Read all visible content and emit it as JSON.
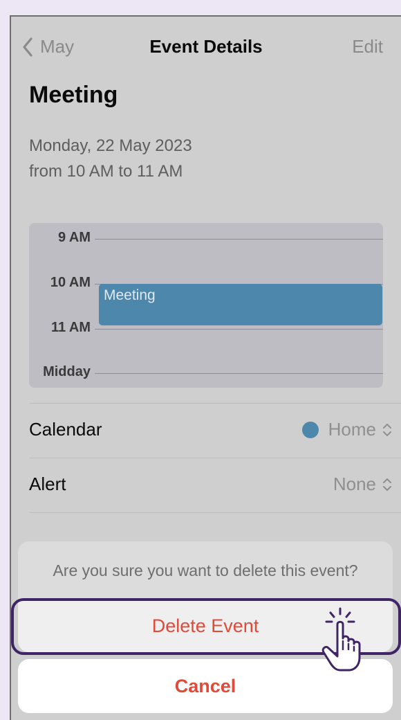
{
  "nav": {
    "back_label": "May",
    "title": "Event Details",
    "edit_label": "Edit"
  },
  "event": {
    "title": "Meeting",
    "date": "Monday, 22 May 2023",
    "time": "from 10 AM to 11 AM"
  },
  "timeline": {
    "hours": [
      "9 AM",
      "10 AM",
      "11 AM",
      "Midday"
    ],
    "event_label": "Meeting",
    "event_color": "#4d87ac"
  },
  "details": {
    "calendar": {
      "label": "Calendar",
      "value": "Home"
    },
    "alert": {
      "label": "Alert",
      "value": "None"
    }
  },
  "action_sheet": {
    "message": "Are you sure you want to delete this event?",
    "delete_label": "Delete Event",
    "cancel_label": "Cancel",
    "destructive_color": "#df4a3a"
  },
  "icons": {
    "back": "chevron-left-icon",
    "calendar_color": "circle-icon",
    "selector": "chevron-up-down-icon",
    "pointer": "hand-pointer-icon"
  },
  "colors": {
    "background": "#ede7f5",
    "highlight": "#3f2466"
  }
}
